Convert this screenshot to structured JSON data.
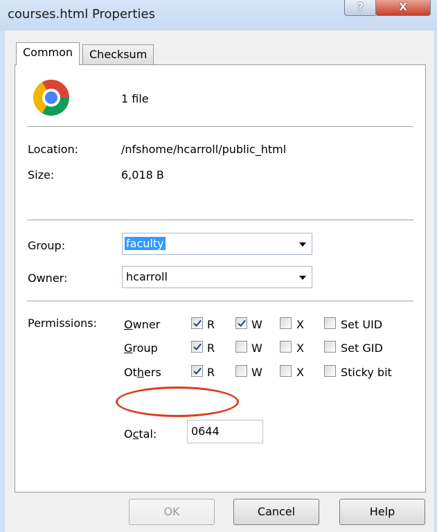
{
  "window": {
    "title": "courses.html Properties",
    "help_label": "?",
    "close_label": "X"
  },
  "tabs": [
    {
      "label": "Common",
      "selected": true
    },
    {
      "label": "Checksum",
      "selected": false
    }
  ],
  "file": {
    "icon": "chrome-icon",
    "count_text": "1 file"
  },
  "info": {
    "location_label": "Location:",
    "location_value": "/nfshome/hcarroll/public_html",
    "size_label": "Size:",
    "size_value": "6,018 B"
  },
  "group": {
    "label": "Group:",
    "value": "faculty"
  },
  "owner": {
    "label": "Owner:",
    "value": "hcarroll"
  },
  "permissions": {
    "label": "Permissions:",
    "rows": [
      {
        "pre": "",
        "ul": "O",
        "post": "wner",
        "r": true,
        "w": true,
        "x": false,
        "special": "Set UID",
        "special_checked": false
      },
      {
        "pre": "",
        "ul": "G",
        "post": "roup",
        "r": true,
        "w": false,
        "x": false,
        "special": "Set GID",
        "special_checked": false
      },
      {
        "pre": "Ot",
        "ul": "h",
        "post": "ers",
        "r": true,
        "w": false,
        "x": false,
        "special": "Sticky bit",
        "special_checked": false
      }
    ],
    "r_label": "R",
    "w_label": "W",
    "x_label": "X",
    "octal_pre": "O",
    "octal_ul": "c",
    "octal_post": "tal:",
    "octal_value": "0644"
  },
  "buttons": {
    "ok": "OK",
    "cancel": "Cancel",
    "help": "Help"
  },
  "colors": {
    "highlight": "#3399ff",
    "annotation": "#e03a1c"
  }
}
